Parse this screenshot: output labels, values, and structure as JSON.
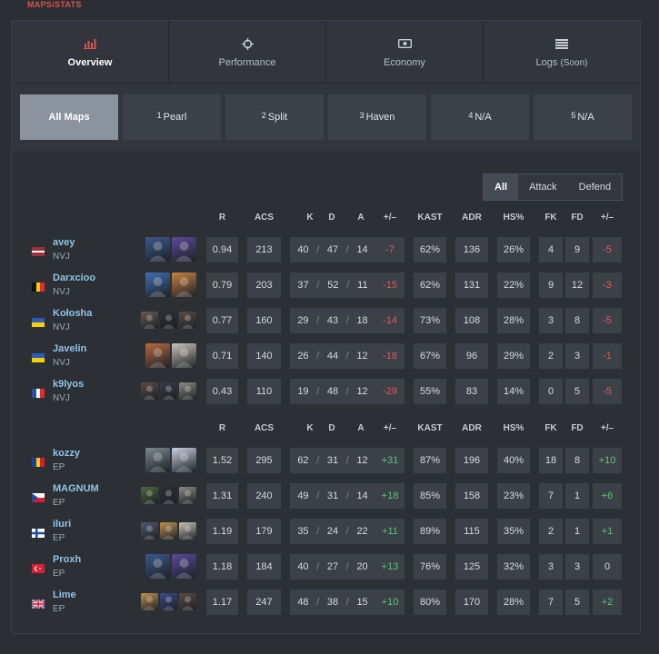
{
  "section_label": "MAPS/STATS",
  "tabs": [
    {
      "label": "Overview",
      "icon": "bar-chart-icon",
      "active": true
    },
    {
      "label": "Performance",
      "icon": "crosshair-icon",
      "active": false
    },
    {
      "label": "Economy",
      "icon": "money-icon",
      "active": false
    },
    {
      "label": "Logs",
      "note": "(Soon)",
      "icon": "list-icon",
      "active": false
    }
  ],
  "maps": [
    {
      "num": "",
      "label": "All Maps",
      "active": true
    },
    {
      "num": "1",
      "label": "Pearl",
      "active": false
    },
    {
      "num": "2",
      "label": "Split",
      "active": false
    },
    {
      "num": "3",
      "label": "Haven",
      "active": false
    },
    {
      "num": "4",
      "label": "N/A",
      "active": false
    },
    {
      "num": "5",
      "label": "N/A",
      "active": false
    }
  ],
  "side_filter": {
    "options": [
      "All",
      "Attack",
      "Defend"
    ],
    "selected": "All"
  },
  "columns": {
    "r": "R",
    "acs": "ACS",
    "k": "K",
    "d": "D",
    "a": "A",
    "pm": "+/–",
    "kast": "KAST",
    "adr": "ADR",
    "hs": "HS%",
    "fk": "FK",
    "fd": "FD",
    "fkfd": "+/–"
  },
  "teams": [
    {
      "players": [
        {
          "name": "avey",
          "team": "NVJ",
          "flag": "latvia",
          "agents": [
            "#3a5a8c",
            "#5b4a9a"
          ],
          "r": "0.94",
          "acs": "213",
          "k": "40",
          "d": "47",
          "a": "14",
          "pm": "-7",
          "kast": "62%",
          "adr": "136",
          "hs": "26%",
          "fk": "4",
          "fd": "9",
          "fkfd": "-5"
        },
        {
          "name": "Darxcioo",
          "team": "NVJ",
          "flag": "belgium",
          "agents": [
            "#3f6fb0",
            "#c9803f"
          ],
          "r": "0.79",
          "acs": "203",
          "k": "37",
          "d": "52",
          "a": "11",
          "pm": "-15",
          "kast": "62%",
          "adr": "131",
          "hs": "22%",
          "fk": "9",
          "fd": "12",
          "fkfd": "-3"
        },
        {
          "name": "Kołosha",
          "team": "NVJ",
          "flag": "ukraine",
          "agents": [
            "#6b5a50",
            "#2e2e3a",
            "#5a4b40"
          ],
          "small": true,
          "r": "0.77",
          "acs": "160",
          "k": "29",
          "d": "43",
          "a": "18",
          "pm": "-14",
          "kast": "73%",
          "adr": "108",
          "hs": "28%",
          "fk": "3",
          "fd": "8",
          "fkfd": "-5"
        },
        {
          "name": "Javelin",
          "team": "NVJ",
          "flag": "ukraine",
          "agents": [
            "#b66a3e",
            "#c9c4b8"
          ],
          "r": "0.71",
          "acs": "140",
          "k": "26",
          "d": "44",
          "a": "12",
          "pm": "-18",
          "kast": "67%",
          "adr": "96",
          "hs": "29%",
          "fk": "2",
          "fd": "3",
          "fkfd": "-1"
        },
        {
          "name": "k9lyos",
          "team": "NVJ",
          "flag": "france",
          "agents": [
            "#5a4b40",
            "#3a3a48",
            "#8a8a80"
          ],
          "small": true,
          "r": "0.43",
          "acs": "110",
          "k": "19",
          "d": "48",
          "a": "12",
          "pm": "-29",
          "kast": "55%",
          "adr": "83",
          "hs": "14%",
          "fk": "0",
          "fd": "5",
          "fkfd": "-5"
        }
      ]
    },
    {
      "players": [
        {
          "name": "kozzy",
          "team": "EP",
          "flag": "romania",
          "agents": [
            "#7a8a8e",
            "#c8cfe0"
          ],
          "r": "1.52",
          "acs": "295",
          "k": "62",
          "d": "31",
          "a": "12",
          "pm": "+31",
          "kast": "87%",
          "adr": "196",
          "hs": "40%",
          "fk": "18",
          "fd": "8",
          "fkfd": "+10"
        },
        {
          "name": "MAGNUM",
          "team": "EP",
          "flag": "czechia",
          "agents": [
            "#4a6a3a",
            "#2e2e3a",
            "#8a8a80"
          ],
          "small": true,
          "r": "1.31",
          "acs": "240",
          "k": "49",
          "d": "31",
          "a": "14",
          "pm": "+18",
          "kast": "85%",
          "adr": "158",
          "hs": "23%",
          "fk": "7",
          "fd": "1",
          "fkfd": "+6"
        },
        {
          "name": "iluri",
          "team": "EP",
          "flag": "finland",
          "agents": [
            "#4a5a70",
            "#c0904a",
            "#c9c4b8"
          ],
          "small": true,
          "r": "1.19",
          "acs": "179",
          "k": "35",
          "d": "24",
          "a": "22",
          "pm": "+11",
          "kast": "89%",
          "adr": "115",
          "hs": "35%",
          "fk": "2",
          "fd": "1",
          "fkfd": "+1"
        },
        {
          "name": "Proxh",
          "team": "EP",
          "flag": "turkey",
          "agents": [
            "#3a5a8c",
            "#5b4a9a"
          ],
          "r": "1.18",
          "acs": "184",
          "k": "40",
          "d": "27",
          "a": "20",
          "pm": "+13",
          "kast": "76%",
          "adr": "125",
          "hs": "32%",
          "fk": "3",
          "fd": "3",
          "fkfd": "0"
        },
        {
          "name": "Lime",
          "team": "EP",
          "flag": "uk",
          "agents": [
            "#c0904a",
            "#3a4a8a",
            "#5a4b40"
          ],
          "small": true,
          "r": "1.17",
          "acs": "247",
          "k": "48",
          "d": "38",
          "a": "15",
          "pm": "+10",
          "kast": "80%",
          "adr": "170",
          "hs": "28%",
          "fk": "7",
          "fd": "5",
          "fkfd": "+2"
        }
      ]
    }
  ]
}
